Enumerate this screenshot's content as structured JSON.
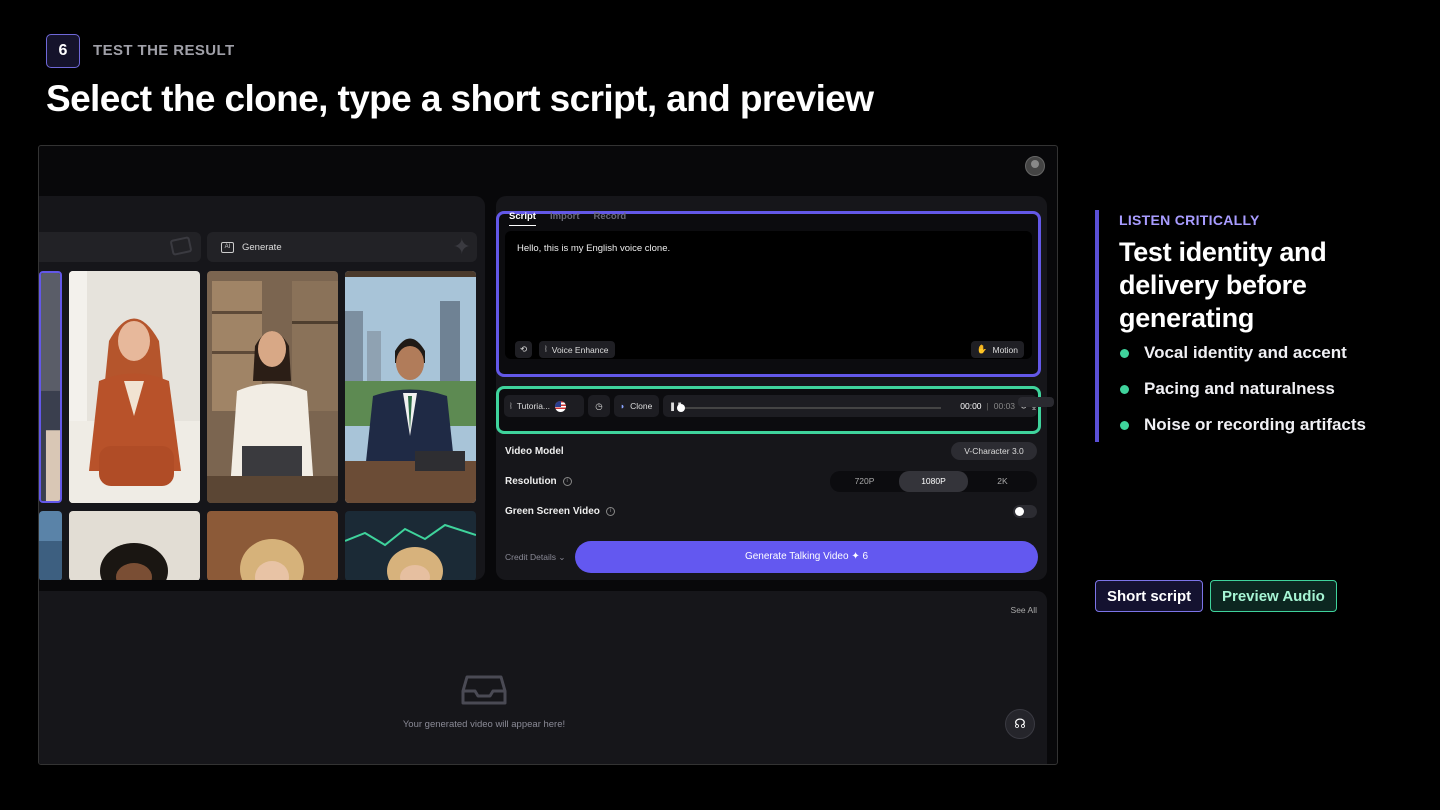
{
  "step": {
    "number": "6",
    "label": "TEST THE RESULT"
  },
  "headline": "Select the clone, type a short script, and preview",
  "app": {
    "left_panel": {
      "generate_tab": "Generate",
      "ai_badge": "AI"
    },
    "script": {
      "tabs": [
        "Script",
        "Import",
        "Record"
      ],
      "text": "Hello, this is my English voice clone.",
      "voice_enhance": "Voice Enhance",
      "motion": "Motion"
    },
    "audio": {
      "voice_name": "Tutoria...",
      "clone_label": "Clone",
      "time_current": "00:00",
      "time_separator": "|",
      "time_total": "00:03",
      "progress": 0
    },
    "settings": {
      "video_model_label": "Video Model",
      "video_model_value": "V-Character 3.0",
      "resolution_label": "Resolution",
      "resolution_options": [
        "720P",
        "1080P",
        "2K"
      ],
      "resolution_selected": "1080P",
      "green_screen_label": "Green Screen Video",
      "green_screen_on": false,
      "credit_details": "Credit Details ⌄",
      "generate_button": "Generate Talking Video ✦ 6"
    },
    "output": {
      "see_all": "See All",
      "empty_message": "Your generated video will appear here!"
    }
  },
  "sidebar": {
    "eyebrow": "LISTEN CRITICALLY",
    "title": "Test identity and delivery before generating",
    "bullets": [
      "Vocal identity and accent",
      "Pacing and naturalness",
      "Noise or recording artifacts"
    ]
  },
  "tags": {
    "script": "Short script",
    "audio": "Preview Audio"
  },
  "colors": {
    "script_highlight": "#6358e8",
    "audio_highlight": "#3fd39c",
    "generate_button": "#6358f0"
  }
}
